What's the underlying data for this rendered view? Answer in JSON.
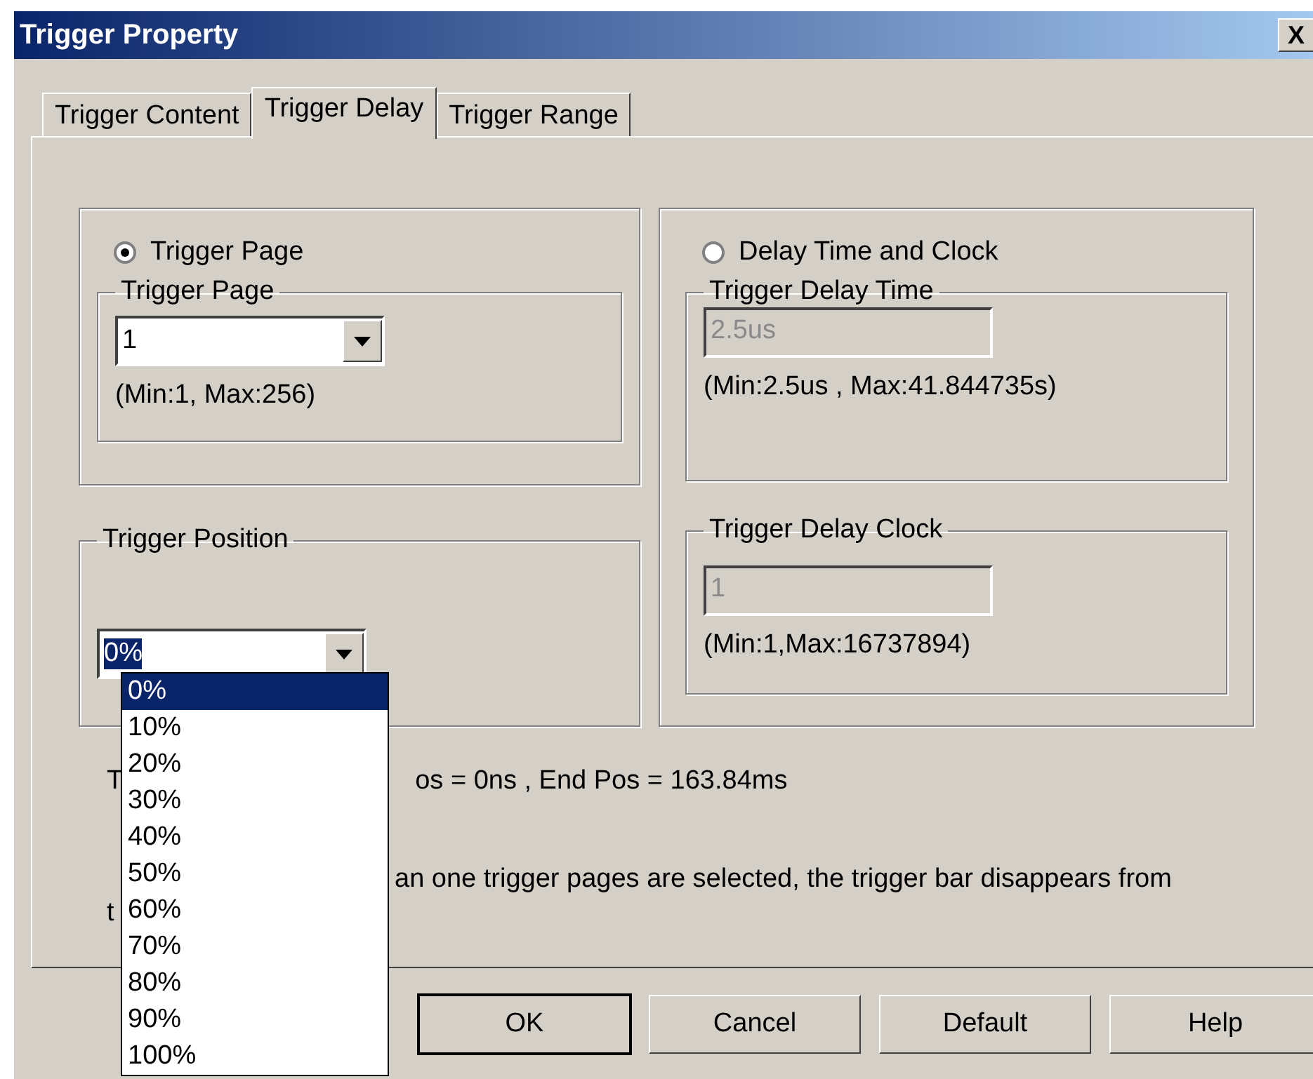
{
  "window": {
    "title": "Trigger Property",
    "close_button": "X"
  },
  "tabs": [
    {
      "label": "Trigger Content",
      "selected": false
    },
    {
      "label": "Trigger Delay",
      "selected": true
    },
    {
      "label": "Trigger Range",
      "selected": false
    }
  ],
  "trigger_page_group": {
    "option": {
      "label": "Trigger Page",
      "selected": true
    },
    "box_title": "Trigger Page",
    "combo_value": "1",
    "range": "(Min:1, Max:256)"
  },
  "delay_group": {
    "option": {
      "label": "Delay Time and Clock",
      "selected": false
    },
    "time": {
      "title": "Trigger Delay Time",
      "value": "2.5us",
      "disabled": true,
      "range": "(Min:2.5us , Max:41.844735s)"
    },
    "clock": {
      "title": "Trigger Delay Clock",
      "value": "1",
      "disabled": true,
      "range": "(Min:1,Max:16737894)"
    }
  },
  "trigger_position": {
    "title": "Trigger Position",
    "combo_value": "0%",
    "value_selected": true,
    "expanded": true,
    "options": [
      {
        "label": "0%",
        "selected": true
      },
      {
        "label": "10%",
        "selected": false
      },
      {
        "label": "20%",
        "selected": false
      },
      {
        "label": "30%",
        "selected": false
      },
      {
        "label": "40%",
        "selected": false
      },
      {
        "label": "50%",
        "selected": false
      },
      {
        "label": "60%",
        "selected": false
      },
      {
        "label": "70%",
        "selected": false
      },
      {
        "label": "80%",
        "selected": false
      },
      {
        "label": "90%",
        "selected": false
      },
      {
        "label": "100%",
        "selected": false
      }
    ]
  },
  "position_info": {
    "visible_start": "T",
    "visible_end": "os = 0ns , End Pos = 163.84ms"
  },
  "note": {
    "line_1_visible_end": "an one trigger pages are selected, the trigger bar disappears from",
    "line_2_visible_start": "t"
  },
  "buttons": [
    {
      "label": "OK",
      "default": true
    },
    {
      "label": "Cancel",
      "default": false
    },
    {
      "label": "Default",
      "default": false
    },
    {
      "label": "Help",
      "default": false
    }
  ]
}
